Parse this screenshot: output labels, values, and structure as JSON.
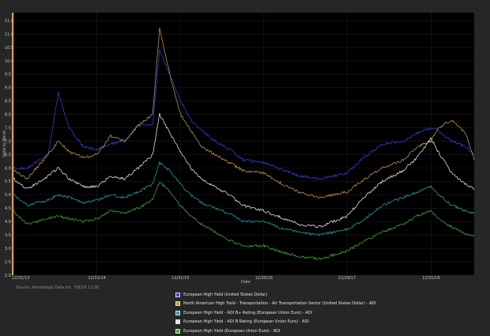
{
  "chart_data": {
    "type": "line",
    "title": "",
    "xlabel": "Date",
    "ylabel": "Yield to Worst",
    "ylim": [
      2.0,
      11.8
    ],
    "y_ticks": [
      2.0,
      2.5,
      3.0,
      3.5,
      4.0,
      4.5,
      5.0,
      5.5,
      6.0,
      6.5,
      7.0,
      7.5,
      8.0,
      8.5,
      9.0,
      9.5,
      10.0,
      10.5,
      11.0,
      11.5
    ],
    "y_tick_labels": [
      "2.0",
      "2.5",
      "3.0",
      "3.5",
      "4.0",
      "4.5",
      "5.0",
      "5.5",
      "6.0",
      "6.5",
      "7.0",
      "7.5",
      "8.0",
      "8.5",
      "9.0",
      "9.5",
      "10.0",
      "10.5",
      "11.0",
      "11.5"
    ],
    "x_ticks": [
      "12/31/13",
      "12/31/14",
      "12/31/15",
      "12/30/16",
      "12/29/17",
      "12/31/18"
    ],
    "grid": true,
    "legend_placement": "bottom",
    "series": [
      {
        "name": "European High Yield (United States Dollar)",
        "color": "#3a3ae6",
        "x": [
          "2013-12-31",
          "2014-03-01",
          "2014-06-01",
          "2014-07-15",
          "2014-09-01",
          "2014-11-01",
          "2014-12-31",
          "2015-03-01",
          "2015-05-01",
          "2015-07-01",
          "2015-09-01",
          "2015-10-01",
          "2015-11-15",
          "2016-01-01",
          "2016-02-15",
          "2016-04-01",
          "2016-06-01",
          "2016-08-01",
          "2016-10-01",
          "2016-12-30",
          "2017-03-01",
          "2017-06-01",
          "2017-09-01",
          "2017-12-29",
          "2018-03-01",
          "2018-06-01",
          "2018-09-01",
          "2018-11-01",
          "2018-12-31",
          "2019-02-01",
          "2019-04-01",
          "2019-06-01",
          "2019-07-08"
        ],
        "values": [
          6.0,
          6.0,
          6.5,
          8.8,
          7.5,
          6.8,
          6.7,
          6.9,
          7.0,
          7.6,
          7.6,
          10.4,
          9.5,
          8.5,
          7.8,
          7.4,
          7.0,
          6.7,
          6.3,
          6.2,
          6.0,
          5.7,
          5.6,
          5.8,
          6.3,
          6.9,
          7.0,
          7.3,
          7.5,
          7.4,
          7.0,
          6.8,
          6.5
        ]
      },
      {
        "name": "North American High Yield - Transportation - Air Transportation Sector (United States Dollar) - ADI",
        "color": "#c99a48",
        "x": [
          "2013-12-31",
          "2014-03-01",
          "2014-06-01",
          "2014-07-15",
          "2014-09-01",
          "2014-11-01",
          "2014-12-31",
          "2015-03-01",
          "2015-05-01",
          "2015-07-01",
          "2015-09-01",
          "2015-10-01",
          "2015-11-15",
          "2016-01-01",
          "2016-02-15",
          "2016-04-01",
          "2016-06-01",
          "2016-08-01",
          "2016-10-01",
          "2016-12-30",
          "2017-03-01",
          "2017-06-01",
          "2017-09-01",
          "2017-12-29",
          "2018-03-01",
          "2018-06-01",
          "2018-09-01",
          "2018-11-01",
          "2018-12-31",
          "2019-02-01",
          "2019-04-01",
          "2019-06-01",
          "2019-07-08"
        ],
        "values": [
          5.9,
          5.6,
          6.5,
          7.0,
          6.6,
          6.4,
          6.5,
          7.2,
          7.0,
          7.6,
          8.0,
          11.2,
          9.5,
          8.0,
          7.4,
          6.8,
          6.5,
          6.2,
          5.9,
          5.8,
          5.5,
          5.1,
          4.9,
          5.1,
          5.5,
          6.0,
          6.3,
          6.8,
          7.0,
          7.5,
          7.8,
          7.3,
          6.3
        ]
      },
      {
        "name": "European High Yield - ADI B+ Rating (European Union Euro) - ADI",
        "color": "#1aa6a6",
        "x": [
          "2013-12-31",
          "2014-03-01",
          "2014-06-01",
          "2014-07-15",
          "2014-09-01",
          "2014-11-01",
          "2014-12-31",
          "2015-03-01",
          "2015-05-01",
          "2015-07-01",
          "2015-09-01",
          "2015-10-01",
          "2015-11-15",
          "2016-01-01",
          "2016-02-15",
          "2016-04-01",
          "2016-06-01",
          "2016-08-01",
          "2016-10-01",
          "2016-12-30",
          "2017-03-01",
          "2017-06-01",
          "2017-09-01",
          "2017-12-29",
          "2018-03-01",
          "2018-06-01",
          "2018-09-01",
          "2018-11-01",
          "2018-12-31",
          "2019-02-01",
          "2019-04-01",
          "2019-06-01",
          "2019-07-08"
        ],
        "values": [
          5.0,
          4.6,
          4.8,
          5.0,
          4.9,
          4.7,
          4.8,
          5.0,
          4.9,
          5.1,
          5.4,
          6.2,
          5.9,
          5.4,
          5.0,
          4.7,
          4.5,
          4.3,
          4.0,
          4.0,
          3.8,
          3.6,
          3.5,
          3.7,
          4.0,
          4.6,
          4.9,
          5.1,
          5.3,
          5.0,
          4.6,
          4.4,
          4.3
        ]
      },
      {
        "name": "European High Yield - ADI B Rating (European Union Euro) - ADI",
        "color": "#e8e8e8",
        "x": [
          "2013-12-31",
          "2014-03-01",
          "2014-06-01",
          "2014-07-15",
          "2014-09-01",
          "2014-11-01",
          "2014-12-31",
          "2015-03-01",
          "2015-05-01",
          "2015-07-01",
          "2015-09-01",
          "2015-10-01",
          "2015-11-15",
          "2016-01-01",
          "2016-02-15",
          "2016-04-01",
          "2016-06-01",
          "2016-08-01",
          "2016-10-01",
          "2016-12-30",
          "2017-03-01",
          "2017-06-01",
          "2017-09-01",
          "2017-12-29",
          "2018-03-01",
          "2018-06-01",
          "2018-09-01",
          "2018-11-01",
          "2018-12-31",
          "2019-02-01",
          "2019-04-01",
          "2019-06-01",
          "2019-07-08"
        ],
        "values": [
          5.6,
          5.2,
          5.7,
          6.0,
          5.6,
          5.3,
          5.3,
          5.7,
          5.6,
          6.0,
          6.5,
          8.0,
          7.3,
          6.6,
          6.0,
          5.6,
          5.3,
          5.0,
          4.6,
          4.4,
          4.2,
          3.9,
          3.8,
          4.2,
          4.8,
          5.5,
          5.9,
          6.4,
          7.1,
          6.6,
          5.8,
          5.4,
          5.2
        ]
      },
      {
        "name": "European High Yield (European Union Euro) - ADI",
        "color": "#3fae34",
        "x": [
          "2013-12-31",
          "2014-03-01",
          "2014-06-01",
          "2014-07-15",
          "2014-09-01",
          "2014-11-01",
          "2014-12-31",
          "2015-03-01",
          "2015-05-01",
          "2015-07-01",
          "2015-09-01",
          "2015-10-01",
          "2015-11-15",
          "2016-01-01",
          "2016-02-15",
          "2016-04-01",
          "2016-06-01",
          "2016-08-01",
          "2016-10-01",
          "2016-12-30",
          "2017-03-01",
          "2017-06-01",
          "2017-09-01",
          "2017-12-29",
          "2018-03-01",
          "2018-06-01",
          "2018-09-01",
          "2018-11-01",
          "2018-12-31",
          "2019-02-01",
          "2019-04-01",
          "2019-06-01",
          "2019-07-08"
        ],
        "values": [
          4.4,
          3.9,
          4.1,
          4.2,
          4.1,
          4.0,
          4.1,
          4.4,
          4.3,
          4.5,
          4.8,
          5.5,
          5.1,
          4.6,
          4.2,
          3.9,
          3.6,
          3.3,
          3.1,
          3.1,
          2.9,
          2.7,
          2.6,
          2.9,
          3.2,
          3.6,
          3.9,
          4.2,
          4.4,
          4.1,
          3.8,
          3.5,
          3.5
        ]
      }
    ]
  },
  "footer": {
    "source": "Source: Advantage Data Inc. 7/8/19 12:26"
  }
}
